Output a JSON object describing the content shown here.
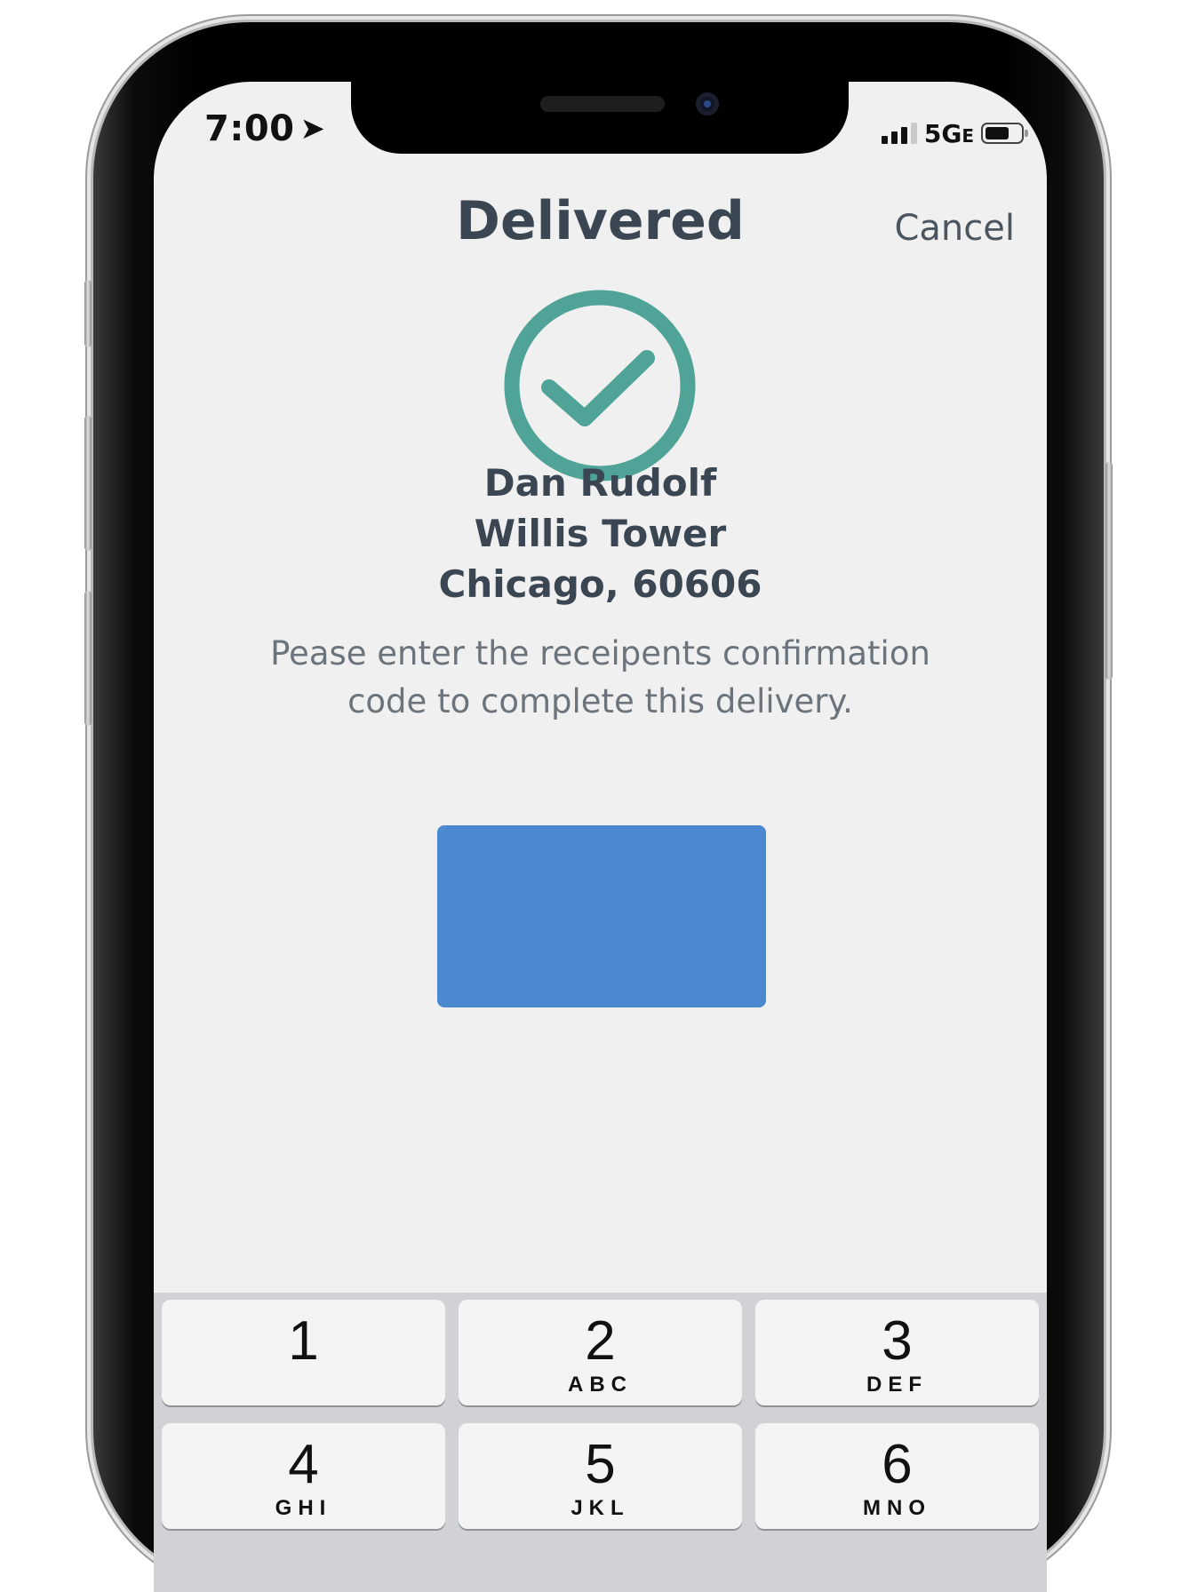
{
  "status_bar": {
    "time": "7:00",
    "location_glyph": "➤",
    "network": "5G",
    "network_suffix": "E"
  },
  "nav": {
    "title": "Delivered",
    "cancel_label": "Cancel"
  },
  "icons": {
    "success": "check-circle-icon"
  },
  "recipient": {
    "name": "Dan Rudolf",
    "building": "Willis Tower",
    "city_zip": "Chicago, 60606"
  },
  "prompt": {
    "line1": "Pease enter the receipents confirmation",
    "line2": "code to complete this delivery."
  },
  "code_input": {
    "value": ""
  },
  "keypad": {
    "keys": [
      {
        "digit": "1",
        "letters": ""
      },
      {
        "digit": "2",
        "letters": "ABC"
      },
      {
        "digit": "3",
        "letters": "DEF"
      },
      {
        "digit": "4",
        "letters": "GHI"
      },
      {
        "digit": "5",
        "letters": "JKL"
      },
      {
        "digit": "6",
        "letters": "MNO"
      }
    ]
  },
  "colors": {
    "accent_teal": "#4fa497",
    "input_blue": "#4a89cf",
    "title_text": "#3a4651",
    "screen_bg": "#f0f0f0"
  }
}
